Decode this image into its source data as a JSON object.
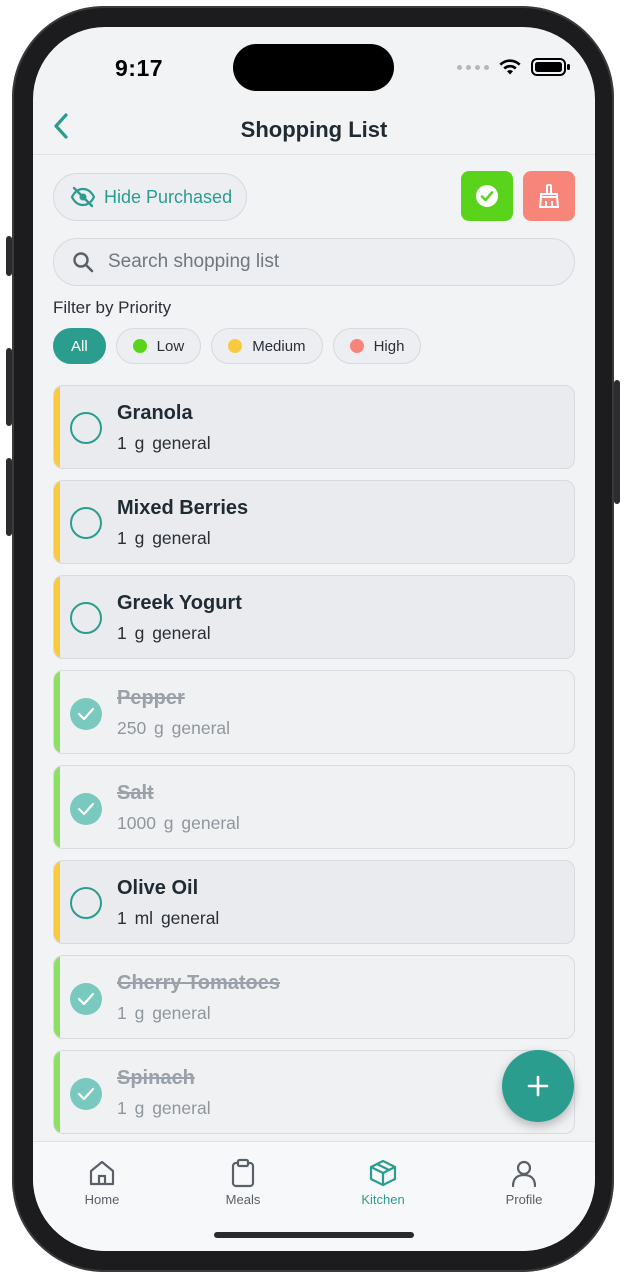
{
  "status": {
    "time": "9:17"
  },
  "header": {
    "title": "Shopping List"
  },
  "toolbar": {
    "hide_label": "Hide Purchased"
  },
  "search": {
    "placeholder": "Search shopping list"
  },
  "filter": {
    "label": "Filter by Priority",
    "chips": [
      {
        "label": "All",
        "active": true
      },
      {
        "label": "Low",
        "color": "#5ad41a"
      },
      {
        "label": "Medium",
        "color": "#f9c940"
      },
      {
        "label": "High",
        "color": "#f7857a"
      }
    ]
  },
  "items": [
    {
      "name": "Granola",
      "qty": "1 g",
      "category": "general",
      "purchased": false,
      "bar_color": "#f9c940"
    },
    {
      "name": "Mixed Berries",
      "qty": "1 g",
      "category": "general",
      "purchased": false,
      "bar_color": "#f9c940"
    },
    {
      "name": "Greek Yogurt",
      "qty": "1 g",
      "category": "general",
      "purchased": false,
      "bar_color": "#f9c940"
    },
    {
      "name": "Pepper",
      "qty": "250 g",
      "category": "general",
      "purchased": true,
      "bar_color": "#8ee065"
    },
    {
      "name": "Salt",
      "qty": "1000 g",
      "category": "general",
      "purchased": true,
      "bar_color": "#8ee065"
    },
    {
      "name": "Olive Oil",
      "qty": "1 ml",
      "category": "general",
      "purchased": false,
      "bar_color": "#f9c940"
    },
    {
      "name": "Cherry Tomatoes",
      "qty": "1 g",
      "category": "general",
      "purchased": true,
      "bar_color": "#8ee065"
    },
    {
      "name": "Spinach",
      "qty": "1 g",
      "category": "general",
      "purchased": true,
      "bar_color": "#8ee065"
    }
  ],
  "tabs": [
    {
      "label": "Home",
      "icon": "home-icon"
    },
    {
      "label": "Meals",
      "icon": "clipboard-icon"
    },
    {
      "label": "Kitchen",
      "icon": "box-icon",
      "active": true
    },
    {
      "label": "Profile",
      "icon": "person-icon"
    }
  ],
  "colors": {
    "accent": "#2a9d8f",
    "check_button": "#5ad41a",
    "clear_button": "#f7857a"
  }
}
